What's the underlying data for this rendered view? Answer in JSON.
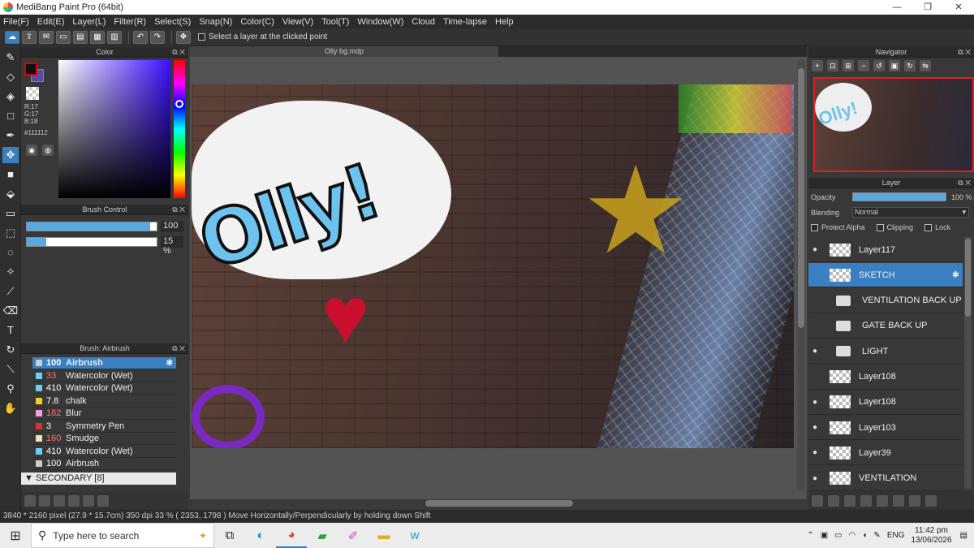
{
  "window": {
    "title": "MediBang Paint Pro (64bit)",
    "min": "—",
    "max": "❐",
    "close": "✕"
  },
  "menu": [
    "File(F)",
    "Edit(E)",
    "Layer(L)",
    "Filter(R)",
    "Select(S)",
    "Snap(N)",
    "Color(C)",
    "View(V)",
    "Tool(T)",
    "Window(W)",
    "Cloud",
    "Time-lapse",
    "Help"
  ],
  "toolbar": {
    "select_layer_label": "Select a layer at the clicked point"
  },
  "color_panel": {
    "title": "Color",
    "r": "R:17",
    "g": "G:17",
    "b": "B:18",
    "hex": "#111112",
    "fg_color": "#111112"
  },
  "brush_control": {
    "title": "Brush Control",
    "size_value": "100",
    "size_fraction": 0.95,
    "opacity_value": "15 %",
    "opacity_fraction": 0.15
  },
  "brush_panel": {
    "title": "Brush: Airbrush",
    "items": [
      {
        "size": "100",
        "name": "Airbrush",
        "color": "#cccccc",
        "size_color": "#ffffff"
      },
      {
        "size": "33",
        "name": "Watercolor (Wet)",
        "color": "#6ad0f0",
        "size_color": "#ff7070"
      },
      {
        "size": "410",
        "name": "Watercolor (Wet)",
        "color": "#6ad0f0",
        "size_color": "#ffffff"
      },
      {
        "size": "7.8",
        "name": "chalk",
        "color": "#f0d020",
        "size_color": "#ffffff"
      },
      {
        "size": "182",
        "name": "Blur",
        "color": "#f0a0e0",
        "size_color": "#ff7070"
      },
      {
        "size": "3",
        "name": "Symmetry Pen",
        "color": "#e03030",
        "size_color": "#ffffff"
      },
      {
        "size": "160",
        "name": "Smudge",
        "color": "#f0e0c0",
        "size_color": "#ff7070"
      },
      {
        "size": "410",
        "name": "Watercolor (Wet)",
        "color": "#6ad0f0",
        "size_color": "#ffffff"
      },
      {
        "size": "100",
        "name": "Airbrush",
        "color": "#cccccc",
        "size_color": "#ffffff"
      }
    ],
    "group_label": "SECONDARY [8]"
  },
  "document": {
    "tab_title": "Olly bg.mdp"
  },
  "navigator": {
    "title": "Navigator"
  },
  "layer_panel": {
    "title": "Layer",
    "opacity_label": "Opacity",
    "opacity_value": "100 %",
    "blending_label": "Blending",
    "blending_value": "Normal",
    "protect_alpha": "Protect Alpha",
    "clipping": "Clipping",
    "lock": "Lock",
    "layers": [
      {
        "name": "Layer117",
        "visible": true,
        "kind": "layer"
      },
      {
        "name": "SKETCH",
        "visible": false,
        "kind": "layer",
        "selected": true
      },
      {
        "name": "VENTILATION BACK UP",
        "visible": false,
        "kind": "folder"
      },
      {
        "name": "GATE BACK UP",
        "visible": false,
        "kind": "folder"
      },
      {
        "name": "LIGHT",
        "visible": true,
        "kind": "folder"
      },
      {
        "name": "Layer108",
        "visible": false,
        "kind": "layer"
      },
      {
        "name": "Layer108",
        "visible": true,
        "kind": "layer"
      },
      {
        "name": "Layer103",
        "visible": true,
        "kind": "layer"
      },
      {
        "name": "Layer39",
        "visible": true,
        "kind": "layer"
      },
      {
        "name": "VENTILATION",
        "visible": true,
        "kind": "layer"
      }
    ]
  },
  "status": {
    "text": "3840 * 2160 pixel   (27.9 * 15.7cm)   350 dpi   33 %   ( 2353, 1798 )   Move Horizontally/Perpendicularly by holding down Shift"
  },
  "taskbar": {
    "search_placeholder": "Type here to search",
    "lang": "ENG",
    "time": "11:42 pm",
    "date": "13/06/2026"
  }
}
